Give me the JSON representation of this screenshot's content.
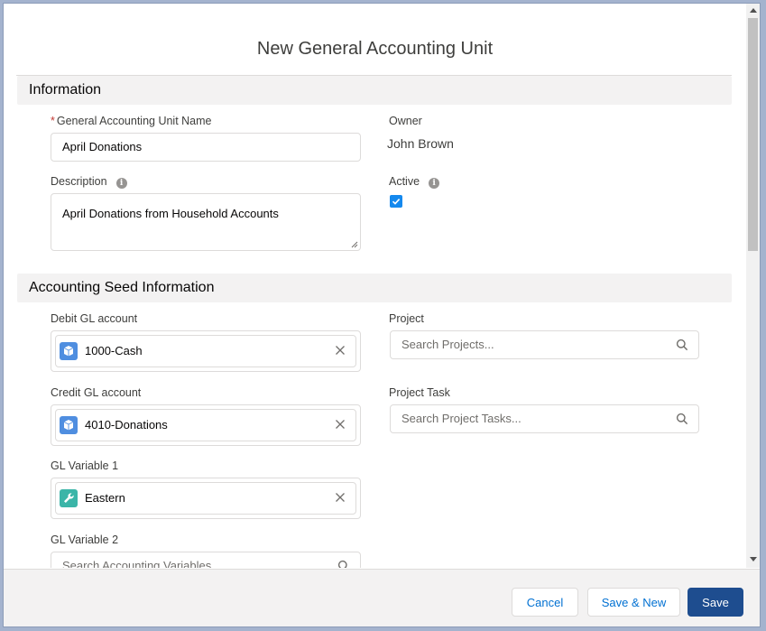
{
  "modal": {
    "title": "New General Accounting Unit"
  },
  "sections": {
    "information": "Information",
    "accounting_seed": "Accounting Seed Information"
  },
  "fields": {
    "gau_name": {
      "label": "General Accounting Unit Name",
      "required_mark": "*",
      "value": "April Donations"
    },
    "owner": {
      "label": "Owner",
      "value": "John Brown"
    },
    "description": {
      "label": "Description",
      "value": "April Donations from Household Accounts"
    },
    "active": {
      "label": "Active",
      "checked": true
    },
    "debit_gl": {
      "label": "Debit GL account",
      "value": "1000-Cash",
      "icon": "cube-icon",
      "color": "#4f8ee0"
    },
    "credit_gl": {
      "label": "Credit GL account",
      "value": "4010-Donations",
      "icon": "cube-icon",
      "color": "#4f8ee0"
    },
    "gl_var1": {
      "label": "GL Variable 1",
      "value": "Eastern",
      "icon": "wrench-icon",
      "color": "#3bb5a8"
    },
    "gl_var2": {
      "label": "GL Variable 2",
      "placeholder": "Search Accounting Variables..."
    },
    "project": {
      "label": "Project",
      "placeholder": "Search Projects..."
    },
    "project_task": {
      "label": "Project Task",
      "placeholder": "Search Project Tasks..."
    }
  },
  "info_icon_glyph": "i",
  "footer": {
    "cancel": "Cancel",
    "save_new": "Save & New",
    "save": "Save"
  }
}
